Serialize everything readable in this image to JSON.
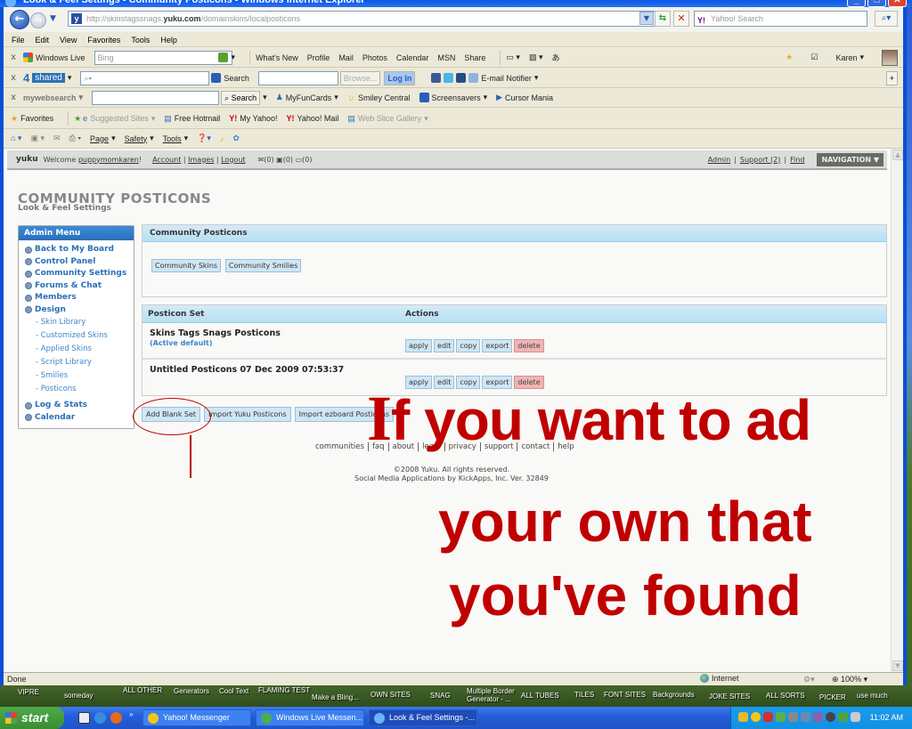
{
  "window": {
    "title": "Look & Feel Settings - Community Posticons - Windows Internet Explorer",
    "controls": [
      "minimize",
      "maximize",
      "close"
    ]
  },
  "address_bar": {
    "url_prefix": "http://skinstagssnags.",
    "url_domain": "yuku.com",
    "url_path": "/domainskins/localposticons",
    "search_placeholder": "Yahoo! Search",
    "search_logo": "Y!"
  },
  "menu": [
    "File",
    "Edit",
    "View",
    "Favorites",
    "Tools",
    "Help"
  ],
  "toolbar_windows_live": {
    "label": "Windows Live",
    "search_placeholder": "Bing",
    "links": [
      "What's New",
      "Profile",
      "Mail",
      "Photos",
      "Calendar",
      "MSN",
      "Share"
    ],
    "user": "Karen"
  },
  "toolbar_4shared": {
    "logo_num": "4",
    "logo_text": "shared",
    "search_label": "Search",
    "browse_label": "Browse...",
    "login_label": "Log In",
    "notifier_label": "E-mail Notifier"
  },
  "toolbar_mywebsearch": {
    "logo": "mywebsearch",
    "search_label": "Search",
    "links": [
      "MyFunCards",
      "Smiley Central",
      "Screensavers",
      "Cursor Mania"
    ]
  },
  "favorites_bar": {
    "favorites_label": "Favorites",
    "links": [
      "Suggested Sites",
      "Free Hotmail",
      "My Yahoo!",
      "Yahoo! Mail",
      "Web Slice Gallery"
    ]
  },
  "command_bar": {
    "items": [
      "Page",
      "Safety",
      "Tools"
    ]
  },
  "yuku_bar": {
    "logo": "yuku",
    "welcome": "Welcome",
    "username": "puppymomkaren",
    "links": [
      "Account",
      "Images",
      "Logout"
    ],
    "counters": [
      "(0)",
      "(0)",
      "(0)"
    ],
    "right_links": [
      "Admin",
      "Support (2)",
      "Find"
    ],
    "navigation_label": "NAVIGATION"
  },
  "page": {
    "title": "COMMUNITY POSTICONS",
    "subtitle": "Look & Feel Settings"
  },
  "admin_menu": {
    "header": "Admin Menu",
    "items": [
      {
        "label": "Back to My Board"
      },
      {
        "label": "Control Panel"
      },
      {
        "label": "Community Settings"
      },
      {
        "label": "Forums & Chat"
      },
      {
        "label": "Members"
      },
      {
        "label": "Design"
      }
    ],
    "design_subitems": [
      "- Skin Library",
      "- Customized Skins",
      "- Applied Skins",
      "- Script Library",
      "- Smilies",
      "- Posticons"
    ],
    "bottom_items": [
      {
        "label": "Log & Stats"
      },
      {
        "label": "Calendar"
      }
    ]
  },
  "community_panel": {
    "header": "Community Posticons",
    "buttons": [
      "Community Skins",
      "Community Smilies"
    ]
  },
  "posticon_table": {
    "columns": [
      "Posticon Set",
      "Actions"
    ],
    "rows": [
      {
        "name": "Skins Tags Snags Posticons",
        "status": "(Active default)"
      },
      {
        "name": "Untitled Posticons 07 Dec 2009 07:53:37",
        "status": ""
      }
    ],
    "actions": [
      "apply",
      "edit",
      "copy",
      "export",
      "delete"
    ]
  },
  "bottom_buttons": [
    "Add Blank Set",
    "Import Yuku Posticons",
    "Import ezboard Posticons"
  ],
  "footer": {
    "links": [
      "communities",
      "faq",
      "about",
      "legal",
      "privacy",
      "support",
      "contact",
      "help"
    ],
    "copyright": "©2008 Yuku. All rights reserved.",
    "powered": "Social Media Applications by KickApps, Inc. Ver. 32849"
  },
  "annotation": {
    "line1_first": "I",
    "line1_rest": "f you want to ad",
    "line2": "your own that",
    "line3": "you've found",
    "color": "#c00000"
  },
  "status_bar": {
    "status": "Done",
    "zone": "Internet",
    "zoom": "100%"
  },
  "desktop_shortcuts": [
    "VIPRE",
    "someday",
    "ALL OTHER",
    "Generators",
    "Cool Text",
    "FLAMING TEST",
    "Make a Bling...",
    "OWN SITES",
    "SNAG",
    "Multiple Border Generator - ...",
    "ALL TUBES",
    "TILES",
    "FONT SITES",
    "Backgrounds",
    "JOKE SITES",
    "ALL SORTS",
    "PICKER",
    "use much"
  ],
  "taskbar": {
    "start_label": "start",
    "tasks": [
      "Yahoo! Messenger",
      "Windows Live Messen...",
      "Look & Feel Settings -..."
    ],
    "clock": "11:02 AM"
  }
}
